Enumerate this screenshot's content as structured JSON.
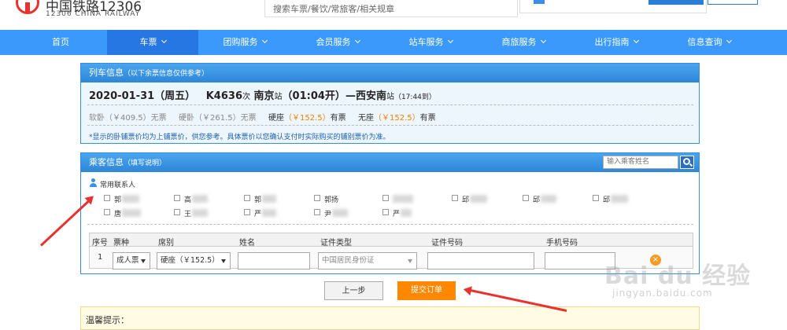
{
  "header": {
    "logo_title": "中国铁路12306",
    "logo_subtitle": "12306 CHINA RAILWAY",
    "search_placeholder": "搜索车票/餐饮/常旅客/相关规章"
  },
  "nav": {
    "items": [
      {
        "label": "首页",
        "has_menu": false
      },
      {
        "label": "车票",
        "has_menu": true,
        "active": true
      },
      {
        "label": "团购服务",
        "has_menu": true
      },
      {
        "label": "会员服务",
        "has_menu": true
      },
      {
        "label": "站车服务",
        "has_menu": true
      },
      {
        "label": "商旅服务",
        "has_menu": true
      },
      {
        "label": "出行指南",
        "has_menu": true
      },
      {
        "label": "信息查询",
        "has_menu": true
      }
    ]
  },
  "train_info": {
    "title": "列车信息",
    "title_note": "（以下余票信息仅供参考）",
    "date": "2020-01-31（周五）",
    "train_no": "K4636",
    "train_suffix": "次",
    "from_station": "南京",
    "station_word": "站",
    "depart": "（01:04开）",
    "to_station": "西安南",
    "arrive": "（17:44到）",
    "dash": "—",
    "seats": [
      {
        "name": "软卧（￥409.5）无票",
        "style": "gray"
      },
      {
        "name": "硬卧（￥261.5）无票",
        "style": "gray"
      },
      {
        "name": "硬座",
        "price": "（￥152.5）",
        "status": "有票"
      },
      {
        "name": "无座",
        "price": "（￥152.5）",
        "status": "有票"
      }
    ],
    "note": "*显示的卧铺票价均为上铺票价，供您参考。具体票价以您确认支付时实际购买的铺别票价为准。"
  },
  "passenger_info": {
    "title": "乘客信息",
    "title_note": "（填写说明）",
    "search_placeholder": "输入乘客姓名",
    "contacts_label": "常用联系人",
    "contacts": [
      "郭",
      "高",
      "郭",
      "郭扬",
      "",
      "邱",
      "邱",
      "邱",
      "唐",
      "王",
      "严",
      "尹",
      "严"
    ],
    "table": {
      "headers": [
        "序号",
        "票种",
        "席别",
        "姓名",
        "证件类型",
        "证件号码",
        "手机号码"
      ],
      "row": {
        "index": "1",
        "ticket_type": "成人票",
        "seat_type": "硬座（￥152.5）",
        "id_type": "中国居民身份证"
      }
    }
  },
  "buttons": {
    "back": "上一步",
    "submit": "提交订单"
  },
  "tips": {
    "title": "温馨提示："
  },
  "watermark": {
    "text": "Bai du 经验",
    "url": "jingyan.baidu.com"
  },
  "colors": {
    "nav_bg": "#3b99fc",
    "nav_active": "#2676e3",
    "submit": "#ff8800",
    "price": "#f37d00",
    "arrow": "#e8322f"
  }
}
